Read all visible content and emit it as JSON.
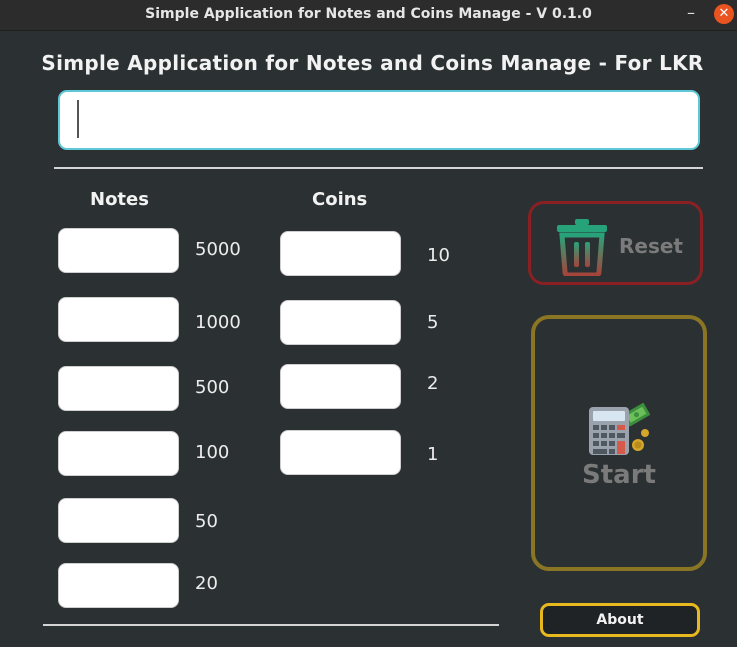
{
  "window": {
    "title": "Simple Application for Notes and Coins Manage - V 0.1.0",
    "minimize_glyph": "–",
    "close_glyph": "✕"
  },
  "header": {
    "title": "Simple Application for Notes and Coins Manage - For LKR"
  },
  "main_input": {
    "value": "",
    "placeholder": ""
  },
  "notes": {
    "heading": "Notes",
    "denominations": [
      "5000",
      "1000",
      "500",
      "100",
      "50",
      "20"
    ]
  },
  "coins": {
    "heading": "Coins",
    "denominations": [
      "10",
      "5",
      "2",
      "1"
    ]
  },
  "buttons": {
    "reset": {
      "label": "Reset",
      "icon": "trash-icon"
    },
    "start": {
      "label": "Start",
      "icon": "calculator-money-icon"
    },
    "about": {
      "label": "About"
    }
  },
  "colors": {
    "background": "#2b3133",
    "reset_border": "#8a2023",
    "start_border": "#8a7524",
    "about_border": "#e8b91e",
    "input_focus": "#5fc7d8"
  }
}
